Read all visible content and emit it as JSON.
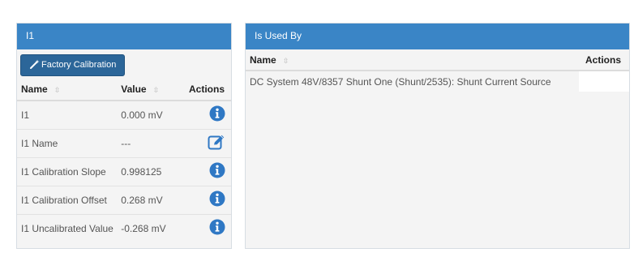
{
  "left_panel": {
    "title": "I1",
    "factory_calibration_label": "Factory Calibration",
    "columns": {
      "name": "Name",
      "value": "Value",
      "actions": "Actions"
    },
    "rows": [
      {
        "name": "I1",
        "value": "0.000 mV",
        "action_icon": "info-icon"
      },
      {
        "name": "I1 Name",
        "value": "---",
        "action_icon": "edit-icon"
      },
      {
        "name": "I1 Calibration Slope",
        "value": "0.998125",
        "action_icon": "info-icon"
      },
      {
        "name": "I1 Calibration Offset",
        "value": "0.268 mV",
        "action_icon": "info-icon"
      },
      {
        "name": "I1 Uncalibrated Value",
        "value": "-0.268 mV",
        "action_icon": "info-icon"
      }
    ]
  },
  "right_panel": {
    "title": "Is Used By",
    "columns": {
      "name": "Name",
      "actions": "Actions"
    },
    "rows": [
      {
        "name": "DC System 48V/8357 Shunt One (Shunt/2535): Shunt Current Source"
      }
    ]
  },
  "colors": {
    "header_blue": "#3a85c6",
    "button_blue": "#2c6699",
    "icon_blue": "#2f78c4"
  },
  "sort_glyph": "⇳"
}
